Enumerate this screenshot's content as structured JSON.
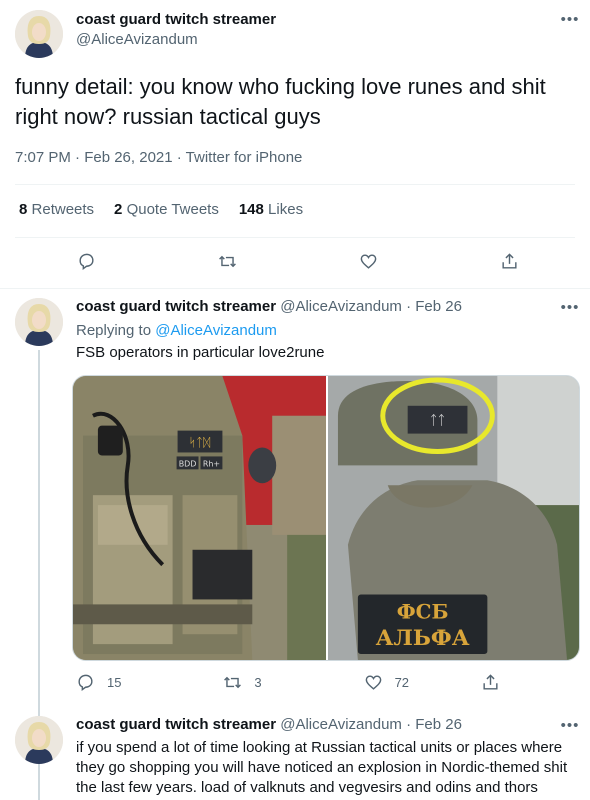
{
  "main_tweet": {
    "display_name": "coast guard twitch streamer",
    "handle": "@AliceAvizandum",
    "text": "funny detail: you know who fucking love runes and shit right now? russian tactical guys",
    "timestamp": "7:07 PM · Feb 26, 2021 · Twitter for iPhone",
    "stats": [
      {
        "count": "8",
        "label": "Retweets"
      },
      {
        "count": "2",
        "label": "Quote Tweets"
      },
      {
        "count": "148",
        "label": "Likes"
      }
    ],
    "icons": [
      "reply-icon",
      "retweet-icon",
      "like-icon",
      "share-icon"
    ]
  },
  "replies": [
    {
      "display_name": "coast guard twitch streamer",
      "handle": "@AliceAvizandum",
      "date": "· Feb 26",
      "replying_prefix": "Replying to ",
      "replying_to": "@AliceAvizandum",
      "text": "FSB operators in particular love2rune",
      "media": {
        "left_patch_runes": "ᛋᛏᛞ",
        "left_patch_sub1": "BDD",
        "left_patch_sub2": "Rh+",
        "right_patch_line1": "ФСБ",
        "right_patch_line2": "АЛЬФА",
        "right_hat_runes": "ᛏᛏ"
      },
      "counts": {
        "replies": "15",
        "retweets": "3",
        "likes": "72"
      }
    },
    {
      "display_name": "coast guard twitch streamer",
      "handle": "@AliceAvizandum",
      "date": "· Feb 26",
      "text": "if you spend a lot of time looking at Russian tactical units or places where they go shopping you will have noticed an explosion in Nordic-themed shit the last few years. load of valknuts and vegvesirs and odins and thors"
    }
  ],
  "colors": {
    "accent": "#1d9bf0",
    "muted": "#536471",
    "text": "#0f1419",
    "divider": "#eff3f4"
  }
}
